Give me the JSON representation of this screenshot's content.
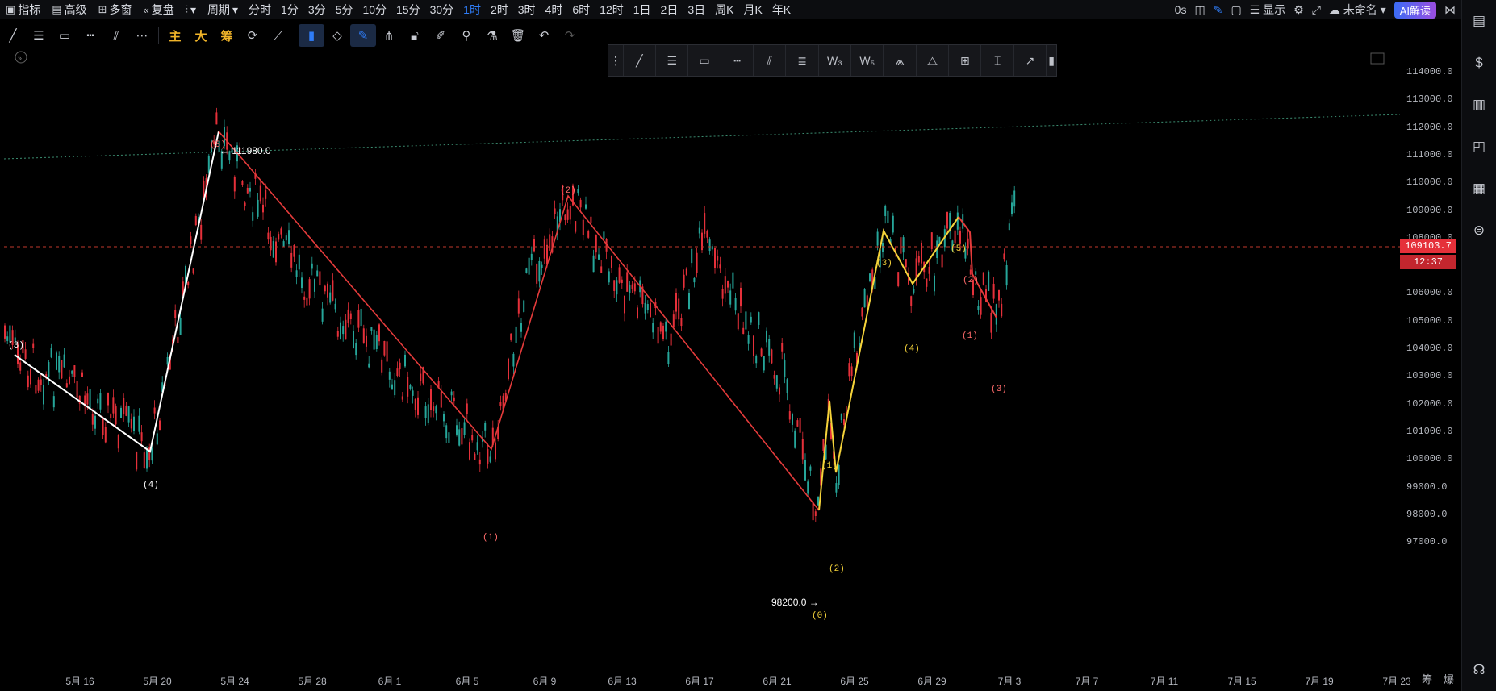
{
  "topbar": {
    "indicators": "指标",
    "advanced": "高级",
    "multi_window": "多窗",
    "replay": "复盘",
    "period_label": "周期",
    "periods": [
      "分时",
      "1分",
      "3分",
      "5分",
      "10分",
      "15分",
      "30分",
      "1时",
      "2时",
      "3时",
      "4时",
      "6时",
      "12时",
      "1日",
      "2日",
      "3日",
      "周K",
      "月K",
      "年K"
    ],
    "active_period": "1时",
    "right": {
      "latency": "0s",
      "display": "显示",
      "unnamed": "未命名",
      "ai": "AI解读"
    }
  },
  "drawing_toolbar": {
    "text_tools": [
      "主",
      "大",
      "筹"
    ]
  },
  "price_axis": {
    "ticks": [
      "114000.0",
      "113000.0",
      "112000.0",
      "111000.0",
      "110000.0",
      "109000.0",
      "108000.0",
      "107000.0",
      "106000.0",
      "105000.0",
      "104000.0",
      "103000.0",
      "102000.0",
      "101000.0",
      "100000.0",
      "99000.0",
      "98000.0",
      "97000.0"
    ],
    "current_price": "109103.7",
    "countdown": "12:37"
  },
  "time_axis": {
    "ticks": [
      "5月 16",
      "5月 20",
      "5月 24",
      "5月 28",
      "6月 1",
      "6月 5",
      "6月 9",
      "6月 13",
      "6月 17",
      "6月 21",
      "6月 25",
      "6月 29",
      "7月 3",
      "7月 7",
      "7月 11",
      "7月 15",
      "7月 19",
      "7月 23"
    ]
  },
  "annotations": {
    "high_price": "← 111980.0",
    "low_price": "98200.0 →"
  },
  "wave_labels": {
    "white": [
      "(3)",
      "(4)"
    ],
    "red_main": [
      "(5)",
      "(1)",
      "(2)"
    ],
    "yellow": [
      "(0)",
      "(1)",
      "(2)",
      "(3)",
      "(4)",
      "(5)"
    ],
    "red_small": [
      "(2)",
      "(1)",
      "(3)"
    ]
  },
  "bottom_right": {
    "a": "筹",
    "b": "爆"
  },
  "colors": {
    "up": "#26a69a",
    "down": "#e5303a",
    "yellow": "#f5d33a",
    "red_line": "#e53b3b",
    "white_line": "#ffffff",
    "accent": "#2f7cf6"
  }
}
